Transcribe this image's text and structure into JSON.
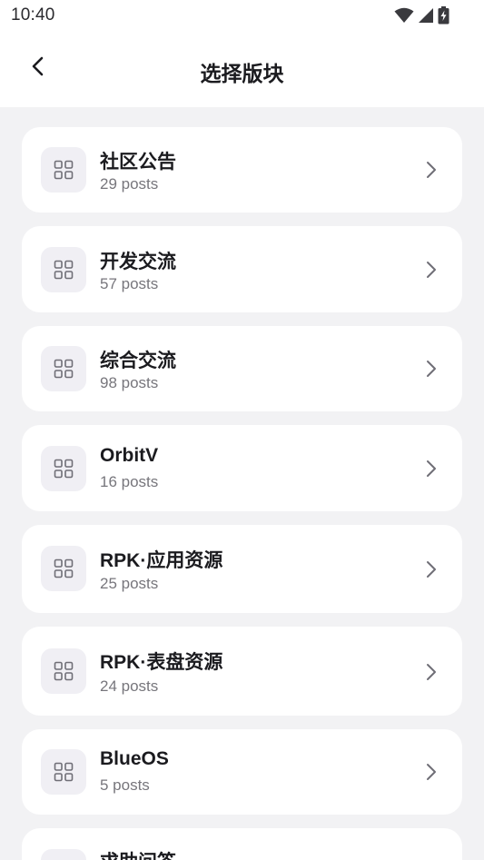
{
  "status_bar": {
    "time": "10:40",
    "icons": [
      "wifi-icon",
      "cellular-signal-icon",
      "battery-charging-icon"
    ]
  },
  "app_bar": {
    "title": "选择版块",
    "back_icon": "chevron-left-icon"
  },
  "boards": [
    {
      "name": "社区公告",
      "count": "29 posts",
      "icon": "grid-icon"
    },
    {
      "name": "开发交流",
      "count": "57 posts",
      "icon": "grid-icon"
    },
    {
      "name": "综合交流",
      "count": "98 posts",
      "icon": "grid-icon"
    },
    {
      "name": "OrbitV",
      "count": "16 posts",
      "icon": "grid-icon"
    },
    {
      "name": "RPK·应用资源",
      "count": "25 posts",
      "icon": "grid-icon"
    },
    {
      "name": "RPK·表盘资源",
      "count": "24 posts",
      "icon": "grid-icon"
    },
    {
      "name": "BlueOS",
      "count": "5 posts",
      "icon": "grid-icon"
    },
    {
      "name": "求助问答",
      "count": "",
      "icon": "grid-icon"
    }
  ],
  "colors": {
    "background": "#f2f2f4",
    "surface": "#ffffff",
    "icon_tile": "#f0eff4",
    "icon_stroke": "#6f6e76",
    "secondary_text": "#77767c"
  }
}
